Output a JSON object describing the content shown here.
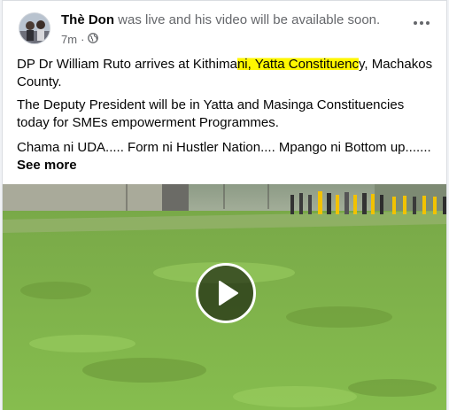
{
  "post": {
    "author": "Thè Don",
    "status": " was live and his video will be available soon.",
    "time": "7m",
    "dot": "·",
    "audience_icon": "globe-icon",
    "menu_icon": "more-icon"
  },
  "body": {
    "p1_before": "DP Dr William Ruto arrives at Kithima",
    "p1_highlight": "ni, Yatta Constituenc",
    "p1_after": "y, Machakos County.",
    "p2": "The Deputy President will be in Yatta and Masinga Constituencies today for SMEs empowerment Programmes.",
    "p3": "Chama ni UDA..... Form ni Hustler Nation.... Mpango ni Bottom up.......",
    "see_more": "See more"
  },
  "video": {
    "play_icon": "play-icon"
  },
  "colors": {
    "highlight": "#fff700",
    "grass": "#7fb64a",
    "uda_yellow": "#f2c200"
  }
}
